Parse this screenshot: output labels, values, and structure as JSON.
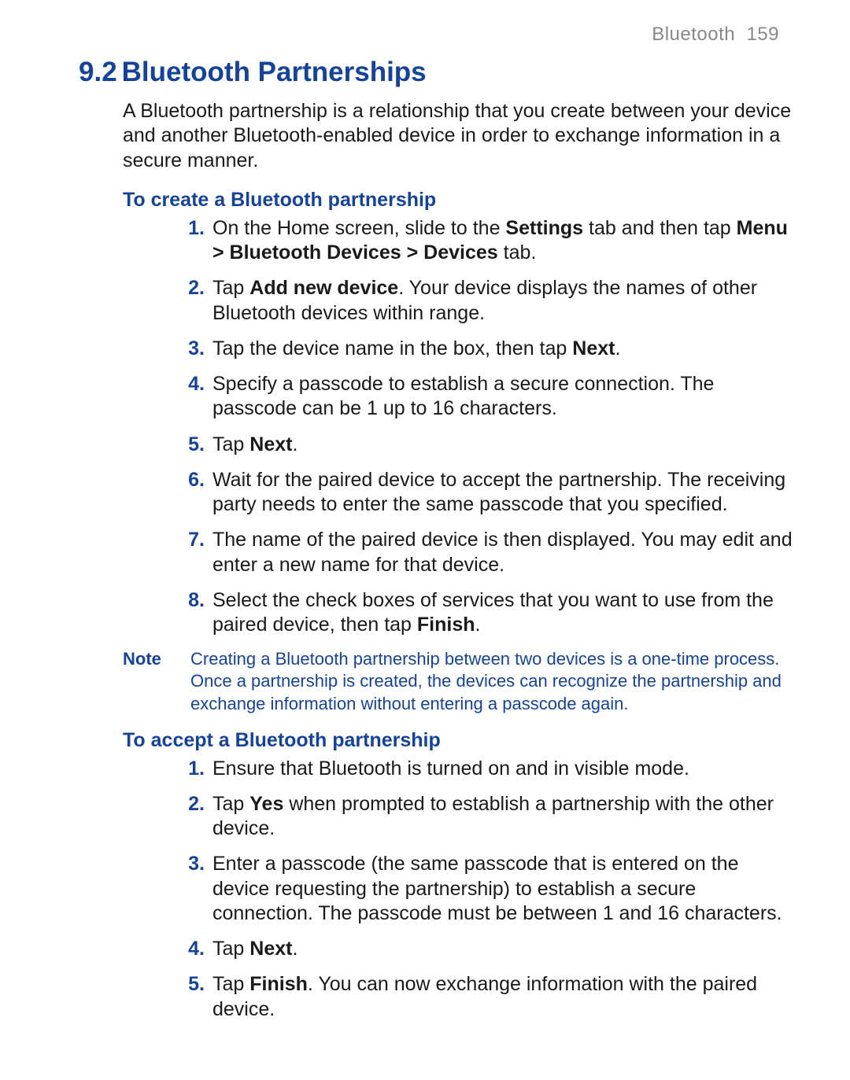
{
  "header": {
    "section_name": "Bluetooth",
    "page_no": "159"
  },
  "section": {
    "number": "9.2",
    "title": "Bluetooth Partnerships"
  },
  "intro": "A Bluetooth partnership is a relationship that you create between your device and another Bluetooth-enabled device in order to exchange information in a secure manner.",
  "create": {
    "title": "To create a Bluetooth partnership",
    "steps": [
      {
        "n": "1.",
        "parts": [
          "On the Home screen, slide to the ",
          "Settings",
          " tab and then tap ",
          "Menu > Bluetooth Devices > Devices",
          " tab."
        ]
      },
      {
        "n": "2.",
        "parts": [
          "Tap ",
          "Add new device",
          ". Your device displays the names of other Bluetooth devices within range."
        ]
      },
      {
        "n": "3.",
        "parts": [
          "Tap the device name in the box, then tap ",
          "Next",
          "."
        ]
      },
      {
        "n": "4.",
        "parts": [
          "Specify a passcode to establish a secure connection. The passcode can be 1 up to 16 characters."
        ]
      },
      {
        "n": "5.",
        "parts": [
          "Tap ",
          "Next",
          "."
        ]
      },
      {
        "n": "6.",
        "parts": [
          "Wait for the paired device to accept the partnership. The receiving party needs to enter the same passcode that you specified."
        ]
      },
      {
        "n": "7.",
        "parts": [
          "The name of the paired device is then displayed. You may edit and enter a new name for that device."
        ]
      },
      {
        "n": "8.",
        "parts": [
          "Select the check boxes of services that you want to use from the paired device, then tap ",
          "Finish",
          "."
        ]
      }
    ]
  },
  "note": {
    "label": "Note",
    "body": "Creating a Bluetooth partnership between two devices is a one-time process. Once a partnership is created, the devices can recognize the partnership and exchange information without entering a passcode again."
  },
  "accept": {
    "title": "To accept a Bluetooth partnership",
    "steps": [
      {
        "n": "1.",
        "parts": [
          "Ensure that Bluetooth is turned on and in visible mode."
        ]
      },
      {
        "n": "2.",
        "parts": [
          "Tap ",
          "Yes",
          " when prompted to establish a partnership with the other device."
        ]
      },
      {
        "n": "3.",
        "parts": [
          "Enter a passcode (the same passcode that is entered on the device requesting the partnership) to establish a secure connection. The passcode must be between 1 and 16 characters."
        ]
      },
      {
        "n": "4.",
        "parts": [
          "Tap ",
          "Next",
          "."
        ]
      },
      {
        "n": "5.",
        "parts": [
          "Tap ",
          "Finish",
          ". You can now exchange information with the paired device."
        ]
      }
    ]
  }
}
